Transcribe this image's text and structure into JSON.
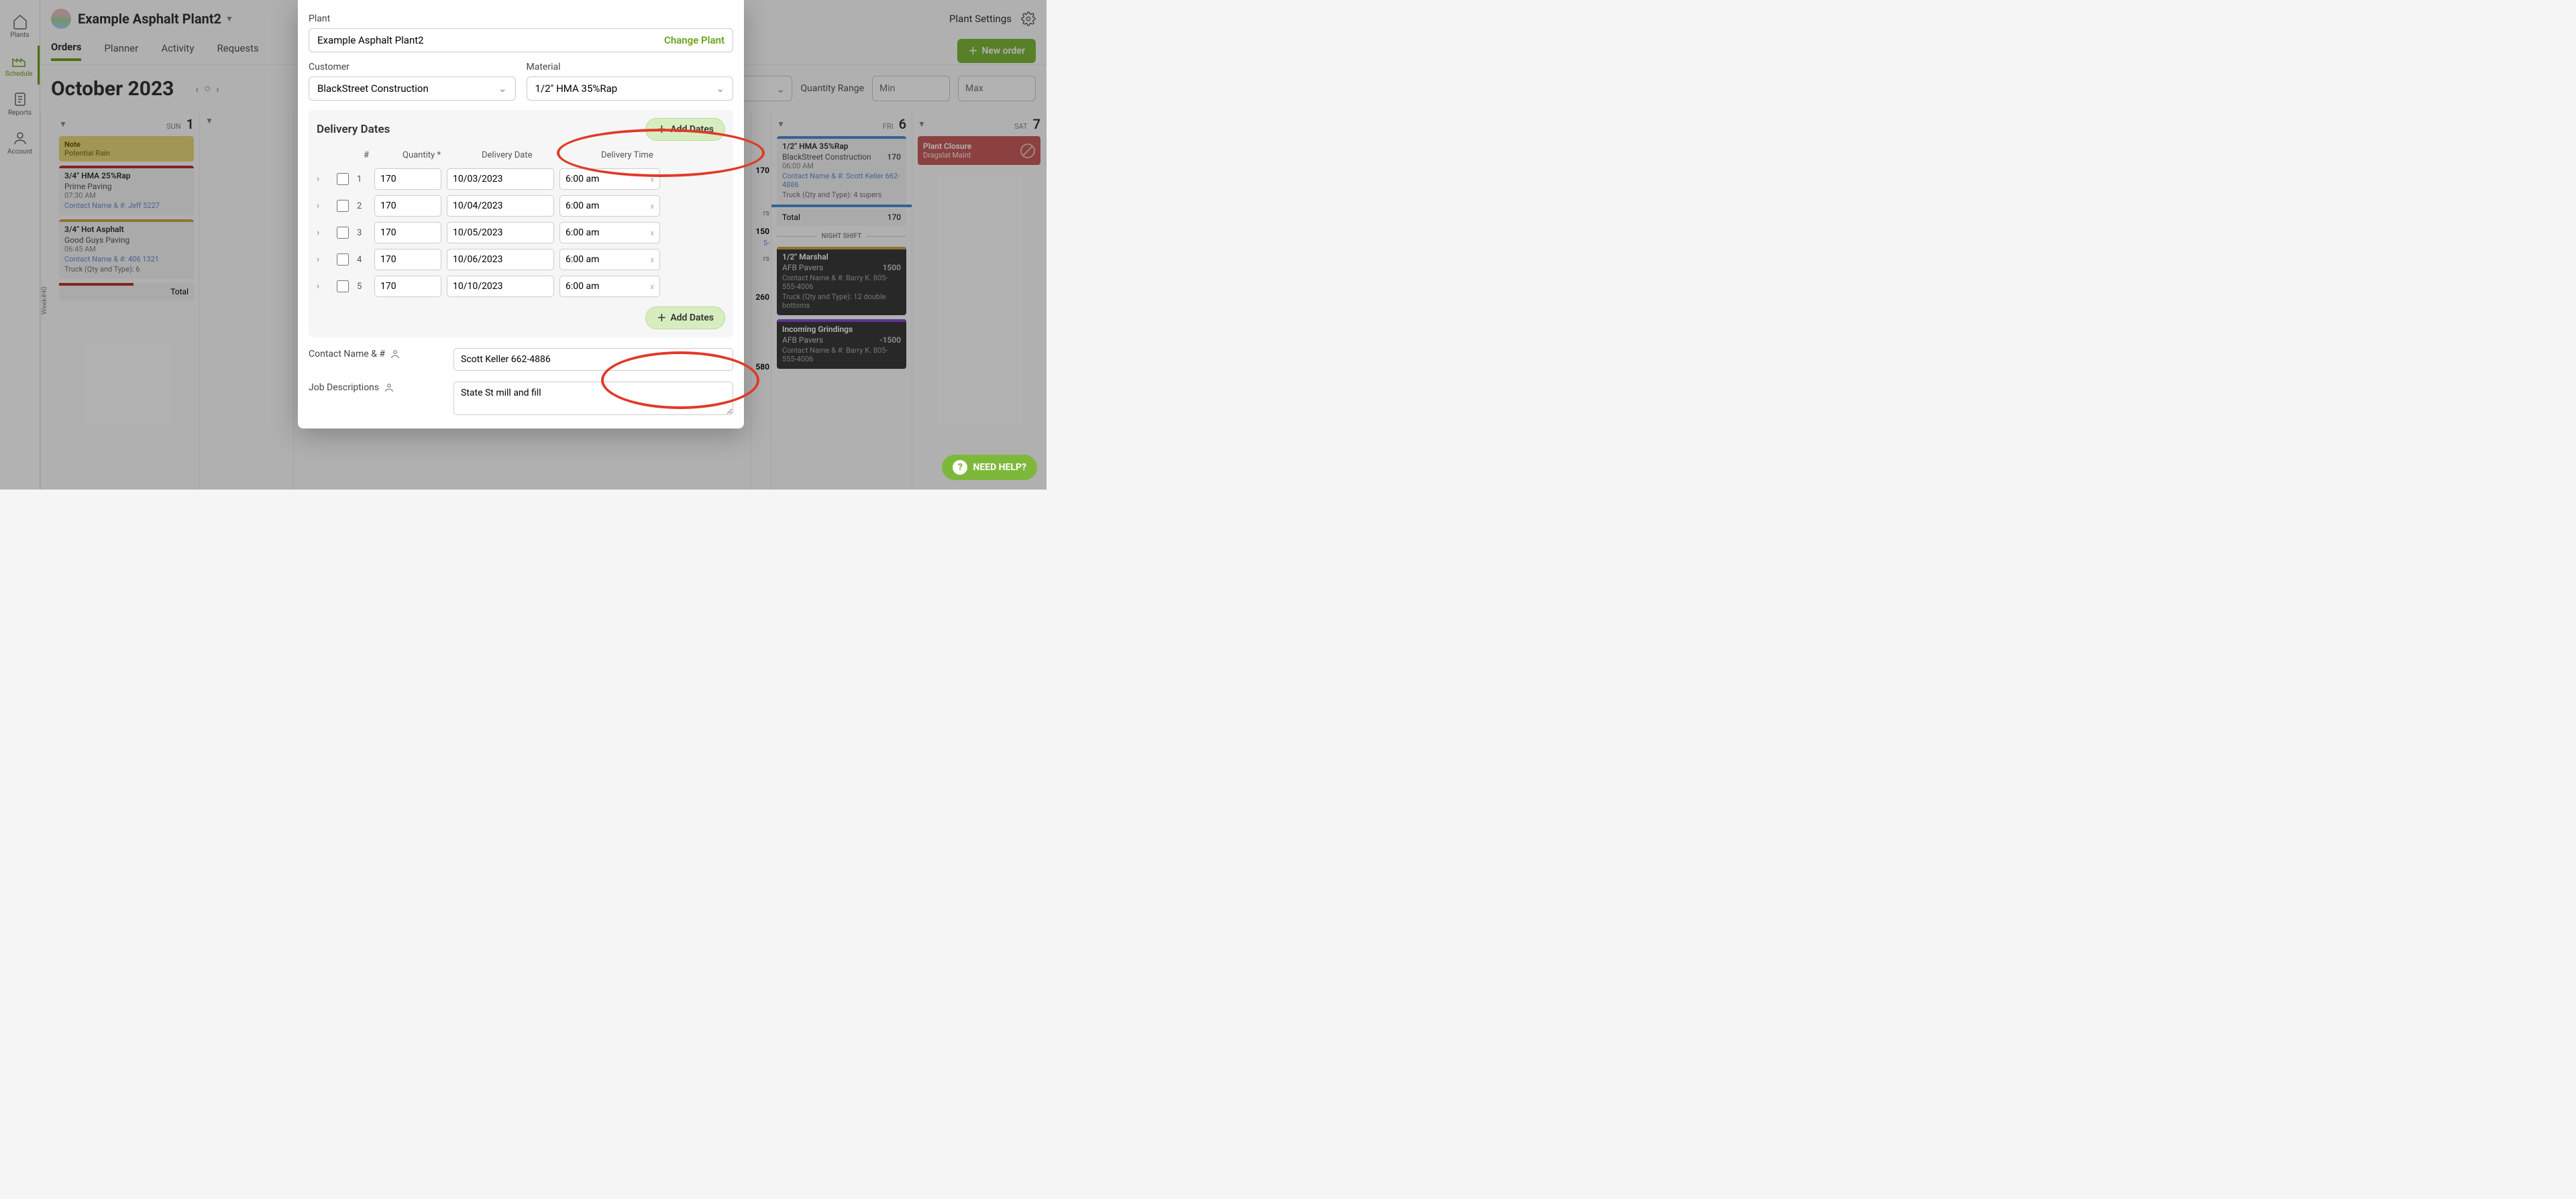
{
  "sidebar": {
    "items": [
      {
        "label": "Plants"
      },
      {
        "label": "Schedule"
      },
      {
        "label": "Reports"
      },
      {
        "label": "Account"
      }
    ]
  },
  "header": {
    "plant_name": "Example Asphalt Plant2",
    "settings_label": "Plant Settings"
  },
  "tabs": {
    "orders": "Orders",
    "planner": "Planner",
    "activity": "Activity",
    "requests": "Requests",
    "new_order": "New order"
  },
  "calendar": {
    "month_title": "October 2023",
    "week_label": "Week#40",
    "qty_range_label": "Quantity Range",
    "min_placeholder": "Min",
    "max_placeholder": "Max",
    "days": {
      "sun": {
        "dow": "SUN",
        "num": "1"
      },
      "fri": {
        "dow": "FRI",
        "num": "6"
      },
      "sat": {
        "dow": "SAT",
        "num": "7"
      }
    },
    "sun_note": {
      "title": "Note",
      "body": "Potential Rain"
    },
    "sun_cards": [
      {
        "mat": "3/4\" HMA 25%Rap",
        "cust": "Prime Paving",
        "time": "07:30 AM",
        "contact": "Contact Name & #: Jeff 5227"
      },
      {
        "mat": "3/4\" Hot Asphalt",
        "cust": "Good Guys Paving",
        "time": "06:45 AM",
        "contact": "Contact Name & #: 406 1321",
        "truck": "Truck (Qty and Type): 6"
      }
    ],
    "sun_total": "Total",
    "thu_frag": {
      "qty1": "170",
      "qty2": "rs",
      "qty3": "150",
      "contact_frag": "5-",
      "suffix_rs": "rs",
      "qty4": "260",
      "qty5": "580"
    },
    "fri_cards": {
      "order1": {
        "mat": "1/2\" HMA 35%Rap",
        "cust": "BlackStreet Construction",
        "qty": "170",
        "time": "06:00 AM",
        "contact": "Contact Name & #: Scott Keller 662-4886",
        "truck": "Truck (Qty and Type): 4 supers"
      },
      "total": {
        "label": "Total",
        "qty": "170"
      },
      "night": "NIGHT SHIFT",
      "order2": {
        "mat": "1/2\" Marshal",
        "cust": "AFB Pavers",
        "qty": "1500",
        "contact": "Contact Name & #: Barry K. 805-555-4006",
        "truck": "Truck (Qty and Type): 12 double bottoms"
      },
      "order3": {
        "mat": "Incoming Grindings",
        "cust": "AFB Pavers",
        "qty": "-1500",
        "contact": "Contact Name & #: Barry K. 805-555-4006"
      }
    },
    "sat_closure": {
      "title": "Plant Closure",
      "body": "Dragslat Maint"
    }
  },
  "modal": {
    "plant_label": "Plant",
    "plant_value": "Example Asphalt Plant2",
    "change_plant": "Change Plant",
    "customer_label": "Customer",
    "customer_value": "BlackStreet Construction",
    "material_label": "Material",
    "material_value": "1/2\" HMA 35%Rap",
    "delivery_dates_title": "Delivery Dates",
    "add_dates": "Add Dates",
    "th_num": "#",
    "th_qty": "Quantity *",
    "th_date": "Delivery Date",
    "th_time": "Delivery Time",
    "rows": [
      {
        "n": "1",
        "qty": "170",
        "date": "10/03/2023",
        "time": "6:00 am"
      },
      {
        "n": "2",
        "qty": "170",
        "date": "10/04/2023",
        "time": "6:00 am"
      },
      {
        "n": "3",
        "qty": "170",
        "date": "10/05/2023",
        "time": "6:00 am"
      },
      {
        "n": "4",
        "qty": "170",
        "date": "10/06/2023",
        "time": "6:00 am"
      },
      {
        "n": "5",
        "qty": "170",
        "date": "10/10/2023",
        "time": "6:00 am"
      }
    ],
    "contact_label": "Contact Name & #",
    "contact_value": "Scott Keller 662-4886",
    "job_label": "Job Descriptions",
    "job_value": "State St mill and fill"
  },
  "help": "NEED HELP?"
}
